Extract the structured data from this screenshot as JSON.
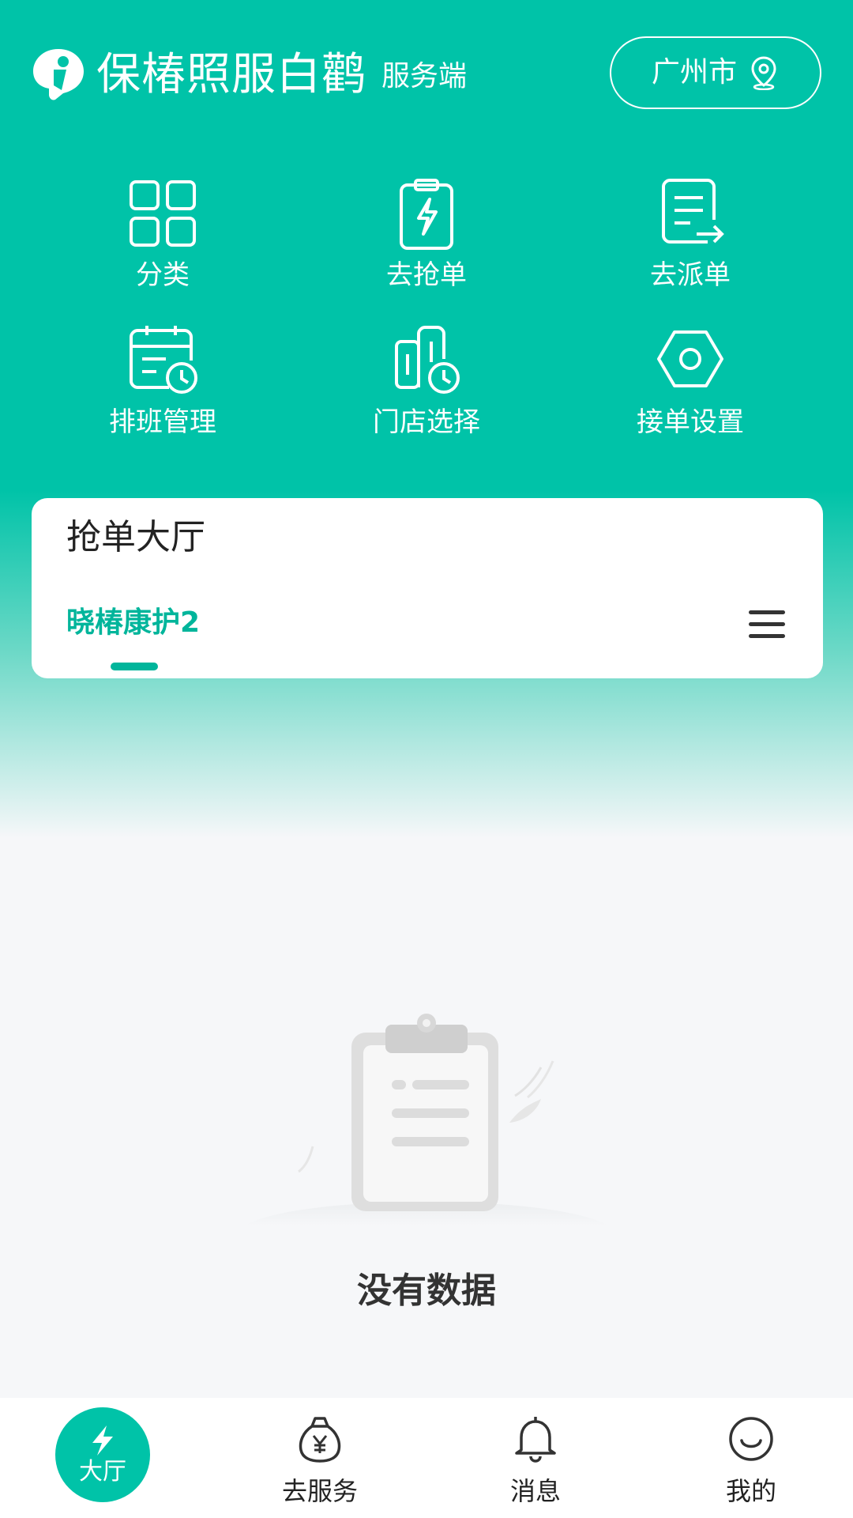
{
  "header": {
    "app_name": "保椿照服白鹳",
    "app_suffix": "服务端",
    "city": "广州市"
  },
  "grid": [
    {
      "label": "分类",
      "icon": "grid-icon"
    },
    {
      "label": "去抢单",
      "icon": "lightning-clipboard-icon"
    },
    {
      "label": "去派单",
      "icon": "document-send-icon"
    },
    {
      "label": "排班管理",
      "icon": "calendar-clock-icon"
    },
    {
      "label": "门店选择",
      "icon": "store-clock-icon"
    },
    {
      "label": "接单设置",
      "icon": "hexagon-settings-icon"
    }
  ],
  "card": {
    "title": "抢单大厅",
    "active_tab": "晓椿康护2"
  },
  "empty_state": {
    "text": "没有数据"
  },
  "bottom_nav": {
    "items": [
      {
        "label": "大厅",
        "icon": "lightning-icon",
        "active": true
      },
      {
        "label": "去服务",
        "icon": "money-bag-icon"
      },
      {
        "label": "消息",
        "icon": "bell-icon"
      },
      {
        "label": "我的",
        "icon": "smiley-icon"
      }
    ]
  },
  "colors": {
    "primary": "#00c3a8",
    "accent_text": "#00b59b",
    "background": "#f6f7f9"
  }
}
